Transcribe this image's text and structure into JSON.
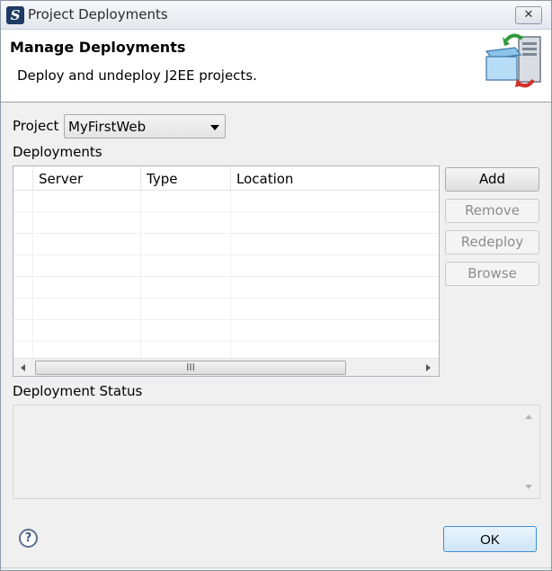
{
  "window": {
    "title": "Project Deployments",
    "app_icon_glyph": "S",
    "close_glyph": "✕"
  },
  "header": {
    "title": "Manage Deployments",
    "description": "Deploy and undeploy J2EE projects."
  },
  "project": {
    "label": "Project",
    "selected": "MyFirstWeb"
  },
  "deployments": {
    "label": "Deployments",
    "columns": [
      "Server",
      "Type",
      "Location"
    ],
    "rows": [],
    "scroll_grip": "III"
  },
  "buttons": {
    "add": "Add",
    "remove": "Remove",
    "redeploy": "Redeploy",
    "browse": "Browse",
    "ok": "OK"
  },
  "status": {
    "label": "Deployment Status",
    "text": ""
  },
  "help": {
    "glyph": "?"
  },
  "colors": {
    "ok_border": "#3c8ed4",
    "disabled_text": "#8d8d8d"
  }
}
